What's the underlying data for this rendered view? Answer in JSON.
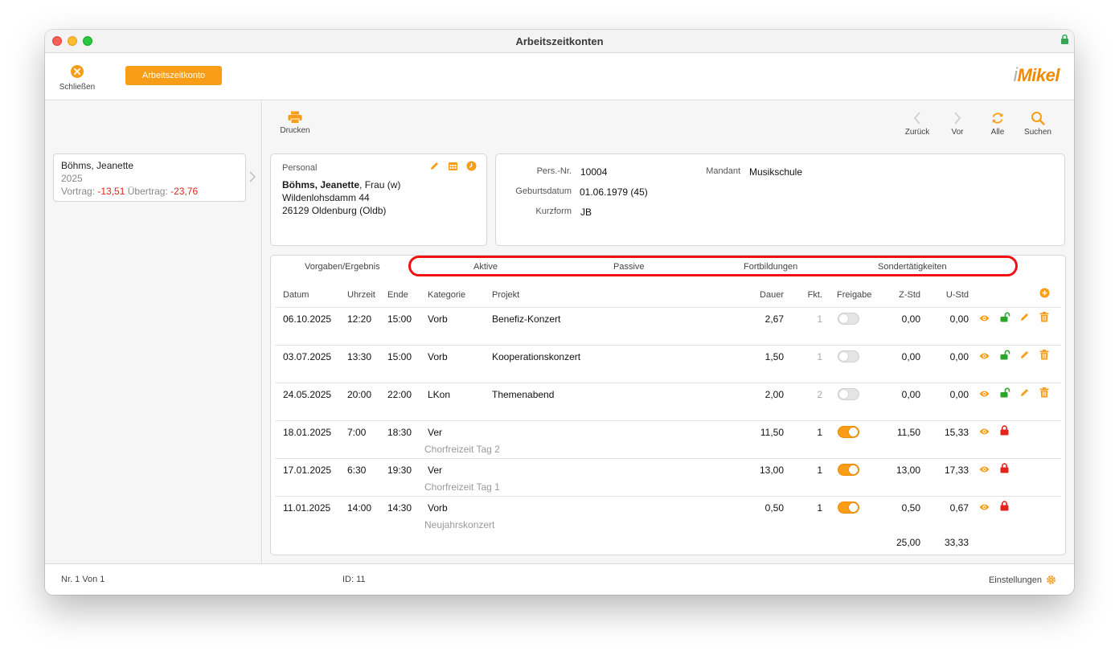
{
  "window": {
    "title": "Arbeitszeitkonten"
  },
  "toolbar": {
    "close_label": "Schließen",
    "primary_label": "Arbeitszeitkonto",
    "logo_i": "i",
    "logo_text": "Mikel"
  },
  "sidebar": {
    "person": {
      "name": "Böhms, Jeanette",
      "year": "2025",
      "vortrag_label": "Vortrag:",
      "vortrag_value": "-13,51",
      "uebertrag_label": "Übertrag:",
      "uebertrag_value": "-23,76"
    }
  },
  "actions": {
    "print_label": "Drucken",
    "back_label": "Zurück",
    "forward_label": "Vor",
    "all_label": "Alle",
    "search_label": "Suchen"
  },
  "personal": {
    "caption": "Personal",
    "name": "Böhms, Jeanette",
    "salutation": ", Frau (w)",
    "street": "Wildenlohsdamm 44",
    "city": "26129 Oldenburg (Oldb)"
  },
  "info": {
    "persnr_label": "Pers.-Nr.",
    "persnr": "10004",
    "mandant_label": "Mandant",
    "mandant": "Musikschule",
    "geburt_label": "Geburtsdatum",
    "geburt": "01.06.1979 (45)",
    "kurz_label": "Kurzform",
    "kurz": "JB"
  },
  "tabs": [
    "Vorgaben/Ergebnis",
    "Aktive",
    "Passive",
    "Fortbildungen",
    "Sondertätigkeiten"
  ],
  "table": {
    "headers": {
      "datum": "Datum",
      "uhrzeit": "Uhrzeit",
      "ende": "Ende",
      "kategorie": "Kategorie",
      "projekt": "Projekt",
      "dauer": "Dauer",
      "fkt": "Fkt.",
      "freigabe": "Freigabe",
      "zstd": "Z-Std",
      "ustd": "U-Std"
    },
    "rows": [
      {
        "datum": "06.10.2025",
        "uhrzeit": "12:20",
        "ende": "15:00",
        "kategorie": "Vorb",
        "projekt": "Benefiz-Konzert",
        "beschreibung": "",
        "dauer": "2,67",
        "fkt": "1",
        "freigabe": false,
        "zstd": "0,00",
        "ustd": "0,00",
        "locked": false
      },
      {
        "datum": "03.07.2025",
        "uhrzeit": "13:30",
        "ende": "15:00",
        "kategorie": "Vorb",
        "projekt": "Kooperationskonzert",
        "beschreibung": "",
        "dauer": "1,50",
        "fkt": "1",
        "freigabe": false,
        "zstd": "0,00",
        "ustd": "0,00",
        "locked": false
      },
      {
        "datum": "24.05.2025",
        "uhrzeit": "20:00",
        "ende": "22:00",
        "kategorie": "LKon",
        "projekt": "Themenabend",
        "beschreibung": "",
        "dauer": "2,00",
        "fkt": "2",
        "freigabe": false,
        "zstd": "0,00",
        "ustd": "0,00",
        "locked": false
      },
      {
        "datum": "18.01.2025",
        "uhrzeit": "7:00",
        "ende": "18:30",
        "kategorie": "Ver",
        "projekt": "",
        "beschreibung": "Chorfreizeit Tag 2",
        "dauer": "11,50",
        "fkt": "1",
        "freigabe": true,
        "zstd": "11,50",
        "ustd": "15,33",
        "locked": true
      },
      {
        "datum": "17.01.2025",
        "uhrzeit": "6:30",
        "ende": "19:30",
        "kategorie": "Ver",
        "projekt": "",
        "beschreibung": "Chorfreizeit Tag 1",
        "dauer": "13,00",
        "fkt": "1",
        "freigabe": true,
        "zstd": "13,00",
        "ustd": "17,33",
        "locked": true
      },
      {
        "datum": "11.01.2025",
        "uhrzeit": "14:00",
        "ende": "14:30",
        "kategorie": "Vorb",
        "projekt": "",
        "beschreibung": "Neujahrskonzert",
        "dauer": "0,50",
        "fkt": "1",
        "freigabe": true,
        "zstd": "0,50",
        "ustd": "0,67",
        "locked": true
      }
    ],
    "totals": {
      "zstd": "25,00",
      "ustd": "33,33"
    }
  },
  "status": {
    "record": "Nr. 1 Von 1",
    "id": "ID: 11",
    "settings_label": "Einstellungen"
  },
  "colors": {
    "accent": "#f99c16",
    "negative": "#e3241b",
    "unlocked": "#2aa52a",
    "locked": "#e3241b",
    "highlight": "#f01212"
  }
}
